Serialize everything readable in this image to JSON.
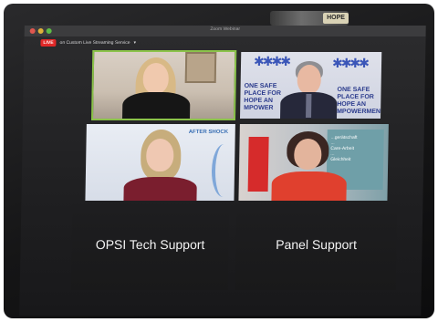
{
  "window": {
    "title": "Zoom Webinar",
    "webcam_logo": "HOPE"
  },
  "livestream": {
    "badge": "LIVE",
    "label": "on Custom Live Streaming Service",
    "chevron": "▾"
  },
  "video_tiles": {
    "tile2_poster_lines": [
      "ONE SAFE",
      "PLACE FOR",
      "HOPE AN",
      "MPOWER"
    ],
    "tile2_poster_right": [
      "ONE SAFE",
      "PLACE FOR",
      "HOPE AN",
      "MPOWERMEN"
    ],
    "tile3_logo": "AFTER SHOCK",
    "tile4_slide_lines": [
      "...gerätschaft",
      "...",
      "Care-Arbeit",
      "...",
      "Gleichheit"
    ]
  },
  "name_tiles": [
    {
      "label": "OPSI Tech Support"
    },
    {
      "label": "Panel Support"
    }
  ],
  "colors": {
    "active_speaker": "#8bc34a",
    "live_badge": "#e02828"
  }
}
